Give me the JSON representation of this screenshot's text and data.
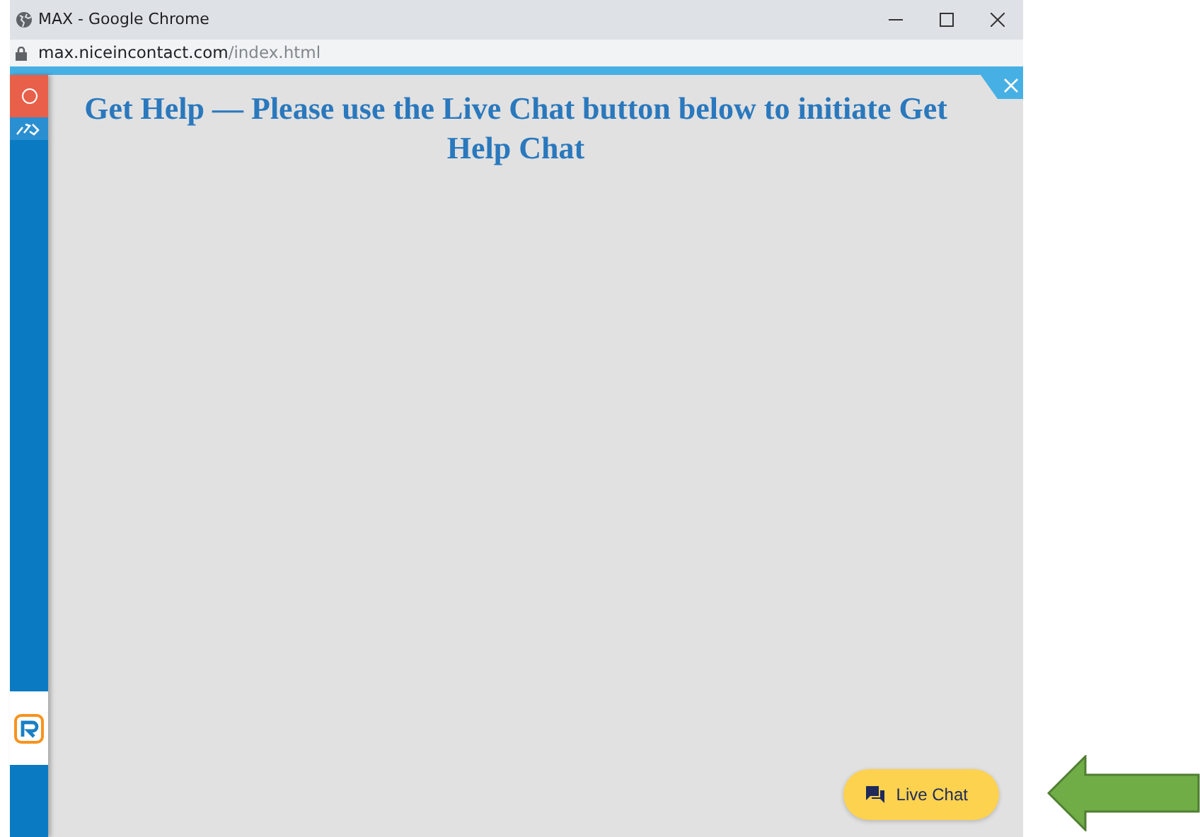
{
  "window": {
    "title": "MAX - Google Chrome"
  },
  "address_bar": {
    "host": "max.niceincontact.com",
    "path": "/index.html"
  },
  "page": {
    "heading": "Get Help — Please use the Live Chat button below to initiate Get Help Chat"
  },
  "live_chat_button": {
    "label": "Live Chat"
  }
}
